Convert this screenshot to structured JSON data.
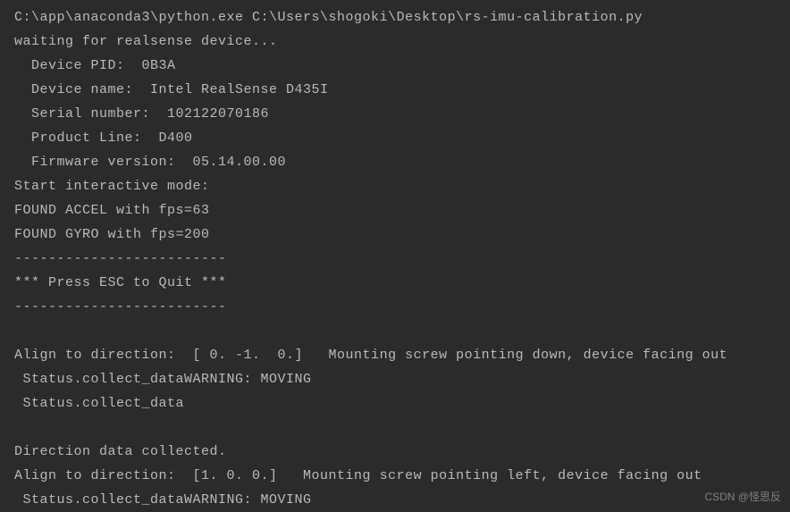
{
  "terminal": {
    "lines": [
      "C:\\app\\anaconda3\\python.exe C:\\Users\\shogoki\\Desktop\\rs-imu-calibration.py",
      "waiting for realsense device...",
      "  Device PID:  0B3A",
      "  Device name:  Intel RealSense D435I",
      "  Serial number:  102122070186",
      "  Product Line:  D400",
      "  Firmware version:  05.14.00.00",
      "Start interactive mode:",
      "FOUND ACCEL with fps=63",
      "FOUND GYRO with fps=200",
      "-------------------------",
      "*** Press ESC to Quit ***",
      "-------------------------",
      "",
      "Align to direction:  [ 0. -1.  0.]   Mounting screw pointing down, device facing out",
      " Status.collect_dataWARNING: MOVING",
      " Status.collect_data",
      "",
      "Direction data collected.",
      "Align to direction:  [1. 0. 0.]   Mounting screw pointing left, device facing out",
      " Status.collect_dataWARNING: MOVING"
    ]
  },
  "watermark": "CSDN @怪思反"
}
